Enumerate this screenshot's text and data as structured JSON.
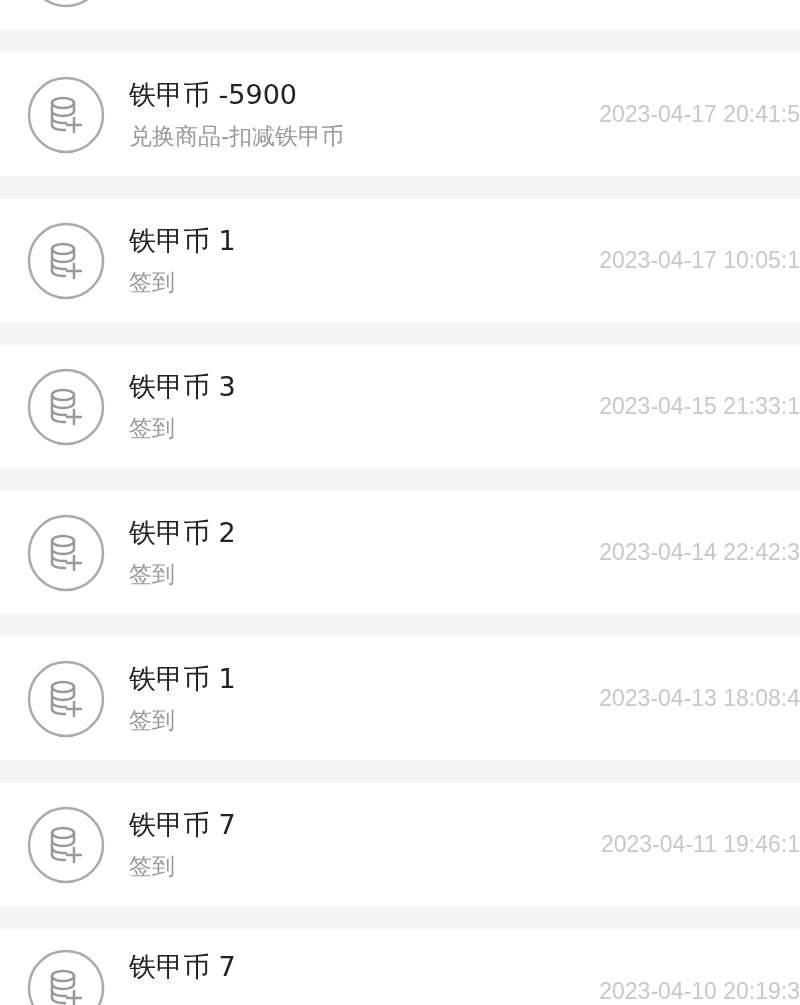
{
  "records": [
    {
      "kind": "partial"
    },
    {
      "kind": "full",
      "title": "铁甲币 -5900",
      "subtitle": "兑换商品-扣减铁甲币",
      "time": "2023-04-17 20:41:5"
    },
    {
      "kind": "full",
      "title": "铁甲币 1",
      "subtitle": "签到",
      "time": "2023-04-17 10:05:1"
    },
    {
      "kind": "full",
      "title": "铁甲币 3",
      "subtitle": "签到",
      "time": "2023-04-15 21:33:1"
    },
    {
      "kind": "full",
      "title": "铁甲币 2",
      "subtitle": "签到",
      "time": "2023-04-14 22:42:3"
    },
    {
      "kind": "full",
      "title": "铁甲币 1",
      "subtitle": "签到",
      "time": "2023-04-13 18:08:4"
    },
    {
      "kind": "full",
      "title": "铁甲币 7",
      "subtitle": "签到",
      "time": "2023-04-11 19:46:1"
    },
    {
      "kind": "cut",
      "title": "铁甲币 7",
      "time": "2023-04-10 20:19:3"
    }
  ]
}
